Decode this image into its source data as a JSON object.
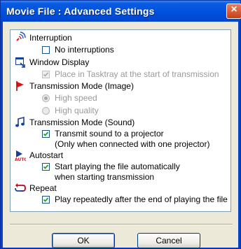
{
  "window": {
    "title": "Movie File : Advanced Settings",
    "close_label": "×"
  },
  "sections": {
    "interruption": {
      "label": "Interruption",
      "icon": "signal-waves-icon",
      "options": [
        {
          "label": "No interruptions",
          "checked": false,
          "enabled": true
        }
      ]
    },
    "window_display": {
      "label": "Window Display",
      "icon": "window-minimize-icon",
      "options": [
        {
          "label": "Place in Tasktray at the start of transmission",
          "checked": true,
          "enabled": false
        }
      ]
    },
    "transmission_image": {
      "label": "Transmission Mode (Image)",
      "icon": "red-flag-icon",
      "options": [
        {
          "label": "High speed",
          "selected": true,
          "enabled": false
        },
        {
          "label": "High quality",
          "selected": false,
          "enabled": false
        }
      ]
    },
    "transmission_sound": {
      "label": "Transmission Mode (Sound)",
      "icon": "music-note-icon",
      "options": [
        {
          "label_line1": "Transmit sound to a projector",
          "label_line2": "(Only when connected with one projector)",
          "checked": true,
          "enabled": true
        }
      ]
    },
    "autostart": {
      "label": "Autostart",
      "icon": "auto-play-icon",
      "options": [
        {
          "label_line1": "Start playing the file automatically",
          "label_line2": "when starting transmission",
          "checked": true,
          "enabled": true
        }
      ]
    },
    "repeat": {
      "label": "Repeat",
      "icon": "repeat-arrows-icon",
      "options": [
        {
          "label": "Play repeatedly after the end of playing the file",
          "checked": true,
          "enabled": true
        }
      ]
    }
  },
  "buttons": {
    "ok": "OK",
    "cancel": "Cancel"
  },
  "colors": {
    "title_bar": "#0050dd",
    "dialog_bg": "#ece9d8",
    "checkbox_check": "#21a121",
    "disabled_text": "#9a9a9a"
  }
}
